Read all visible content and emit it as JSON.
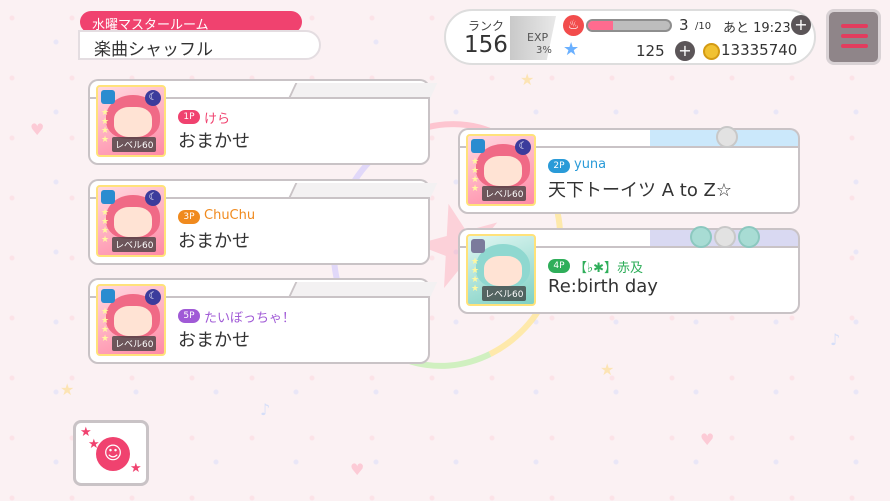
{
  "room": {
    "tag": "水曜マスタールーム",
    "mode": "楽曲シャッフル"
  },
  "status": {
    "rank_label": "ランク",
    "rank": "156",
    "exp_label": "EXP",
    "exp_pct": "3%",
    "exp_fraction": 0.03,
    "energy": "3",
    "energy_max": "/10",
    "energy_fraction": 0.3,
    "energy_timer": "あと 19:23",
    "stars": "125",
    "coins": "13335740"
  },
  "players": [
    {
      "slot": "1P",
      "name": "けら",
      "song": "おまかせ",
      "level": "レベル60",
      "color": "#f0426f"
    },
    {
      "slot": "3P",
      "name": "ChuChu",
      "song": "おまかせ",
      "level": "レベル60",
      "color": "#f08a1e"
    },
    {
      "slot": "5P",
      "name": "たいぼっちゃ！",
      "song": "おまかせ",
      "level": "レベル60",
      "color": "#a05ad6"
    },
    {
      "slot": "2P",
      "name": "yuna",
      "song": "天下トーイツ A to Z☆",
      "level": "レベル60",
      "color": "#2a9bd8"
    },
    {
      "slot": "4P",
      "name": "【♭✱】赤及",
      "song": "Re:birth day",
      "level": "レベル60",
      "color": "#2fae5a"
    }
  ],
  "icons": {
    "flame": "flame-icon",
    "star": "star-icon",
    "coin": "coin-icon",
    "menu": "menu-icon",
    "stamp": "stamp-icon"
  }
}
